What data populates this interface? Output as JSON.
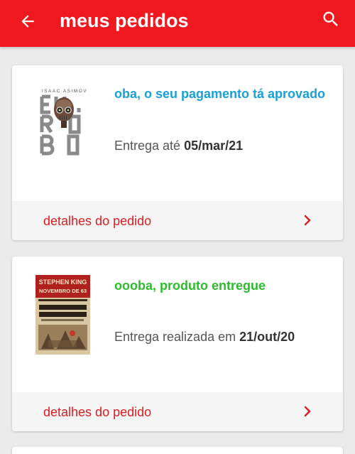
{
  "appbar": {
    "title": "meus pedidos",
    "back_icon": "arrow-back-icon",
    "search_icon": "search-icon",
    "background": "#f0181f"
  },
  "orders": [
    {
      "status": "oba, o seu pagamento tá aprovado",
      "status_color": "#1a9fd6",
      "delivery_label": "Entrega até ",
      "delivery_date": "05/mar/21",
      "details_label": "detalhes do pedido",
      "book_cover": {
        "author": "ISAAC ASIMOV",
        "title_lines": [
          "EU,",
          "RO",
          "BO"
        ]
      }
    },
    {
      "status": "oooba, produto entregue",
      "status_color": "#2dbb2d",
      "delivery_label": "Entrega realizada em ",
      "delivery_date": "21/out/20",
      "details_label": "detalhes do pedido",
      "book_cover": {
        "author": "STEPHEN KING",
        "subtitle": "NOVEMBRO DE 63"
      }
    }
  ],
  "accent": "#dc1c22"
}
